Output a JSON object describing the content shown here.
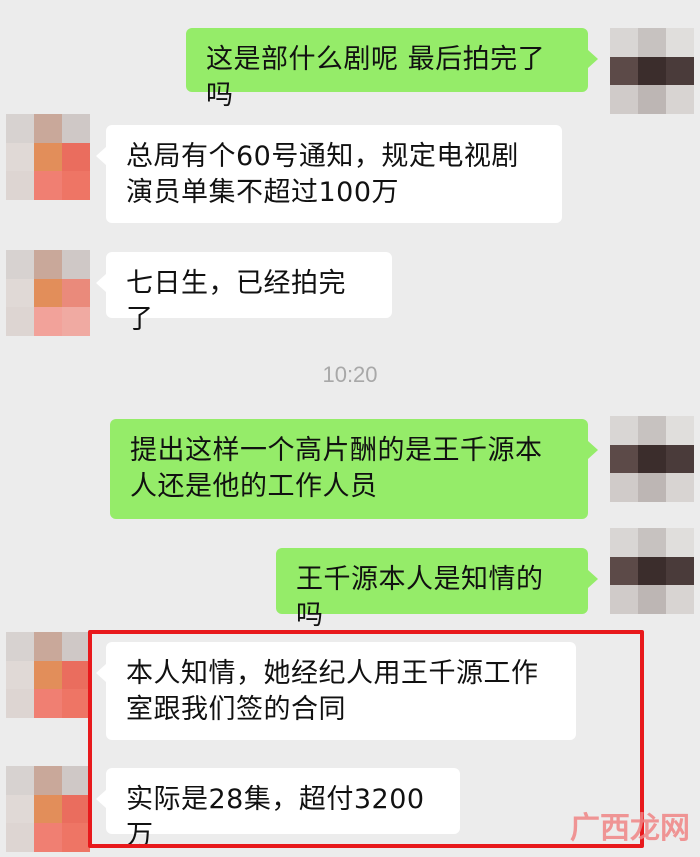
{
  "messages": [
    {
      "side": "right",
      "text": "这是部什么剧呢 最后拍完了吗"
    },
    {
      "side": "left",
      "text": "总局有个60号通知，规定电视剧演员单集不超过100万"
    },
    {
      "side": "left",
      "text": "七日生，已经拍完了"
    },
    {
      "side": "right",
      "text": "提出这样一个高片酬的是王千源本人还是他的工作人员"
    },
    {
      "side": "right",
      "text": "王千源本人是知情的吗"
    },
    {
      "side": "left",
      "text": "本人知情，她经纪人用王千源工作室跟我们签的合同"
    },
    {
      "side": "left",
      "text": "实际是28集，超付3200万"
    }
  ],
  "timestamp": "10:20",
  "watermark": "广西龙网",
  "colors": {
    "background": "#ececec",
    "sent_bubble": "#95ec69",
    "received_bubble": "#ffffff",
    "highlight_border": "#e8191c"
  },
  "avatar_icons": [
    "blurred-avatar-self",
    "blurred-avatar-contact"
  ]
}
